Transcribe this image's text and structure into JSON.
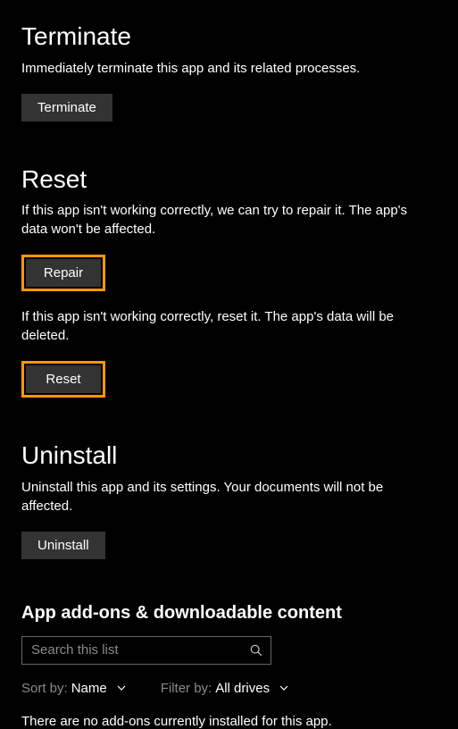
{
  "terminate": {
    "title": "Terminate",
    "desc": "Immediately terminate this app and its related processes.",
    "button": "Terminate"
  },
  "reset": {
    "title": "Reset",
    "repair_desc": "If this app isn't working correctly, we can try to repair it. The app's data won't be affected.",
    "repair_button": "Repair",
    "reset_desc": "If this app isn't working correctly, reset it. The app's data will be deleted.",
    "reset_button": "Reset"
  },
  "uninstall": {
    "title": "Uninstall",
    "desc": "Uninstall this app and its settings. Your documents will not be affected.",
    "button": "Uninstall"
  },
  "addons": {
    "title": "App add-ons & downloadable content",
    "search_placeholder": "Search this list",
    "sort_label": "Sort by:",
    "sort_value": "Name",
    "filter_label": "Filter by:",
    "filter_value": "All drives",
    "empty": "There are no add-ons currently installed for this app."
  }
}
